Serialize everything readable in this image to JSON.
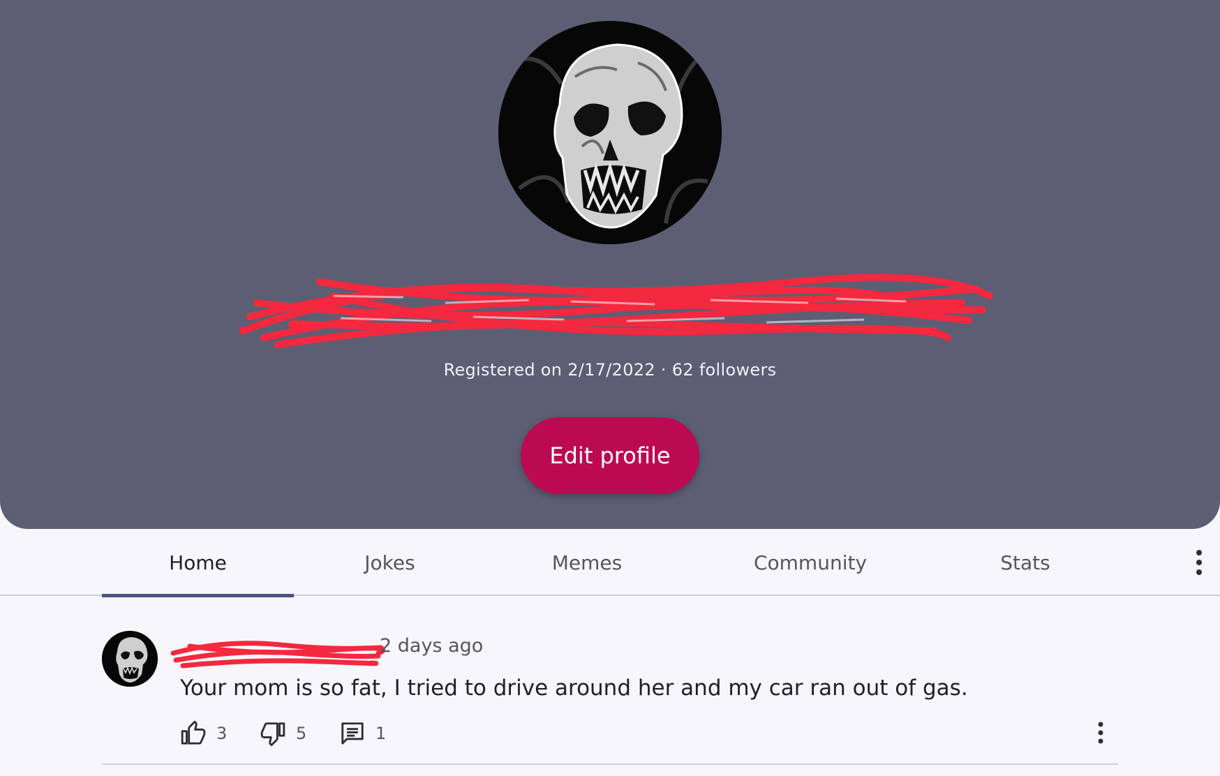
{
  "profile": {
    "avatar_icon": "skull-avatar",
    "name_redacted": true,
    "registered_text": "Registered on 2/17/2022 · 62 followers",
    "edit_button_label": "Edit profile"
  },
  "tabs": [
    {
      "label": "Home",
      "active": true
    },
    {
      "label": "Jokes",
      "active": false
    },
    {
      "label": "Memes",
      "active": false
    },
    {
      "label": "Community",
      "active": false
    },
    {
      "label": "Stats",
      "active": false
    }
  ],
  "tabs_more_icon": "more-vert-icon",
  "post": {
    "author_redacted": true,
    "time": "2 days ago",
    "text": "Your mom is so fat, I tried to drive around her and my car ran out of gas.",
    "likes": "3",
    "dislikes": "5",
    "comments": "1",
    "icons": [
      "thumb-up-icon",
      "thumb-down-icon",
      "comment-icon",
      "more-vert-icon"
    ]
  },
  "colors": {
    "header_bg": "#5c5e74",
    "accent": "#bc0a52",
    "tab_indicator": "#4b5284",
    "redaction": "#f4283e",
    "page_bg": "#f6f6fb"
  }
}
